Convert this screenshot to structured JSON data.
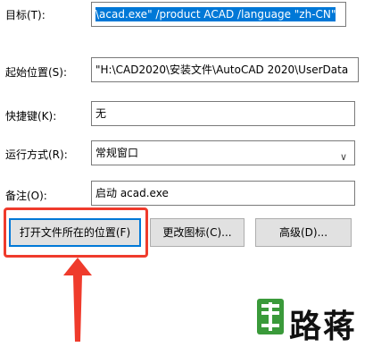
{
  "target": {
    "label": "目标(T):",
    "value": "\\acad.exe\"  /product ACAD /language \"zh-CN\""
  },
  "start_in": {
    "label": "起始位置(S):",
    "value": "\"H:\\CAD2020\\安装文件\\AutoCAD 2020\\UserData"
  },
  "shortcut_key": {
    "label": "快捷键(K):",
    "value": "无"
  },
  "run": {
    "label": "运行方式(R):",
    "value": "常规窗口"
  },
  "comment": {
    "label": "备注(O):",
    "value": "启动 acad.exe"
  },
  "buttons": {
    "open_location": "打开文件所在的位置(F)",
    "change_icon": "更改图标(C)...",
    "advanced": "高级(D)..."
  },
  "watermark": {
    "text": "路蒋",
    "colors": {
      "green": "#3a9a3a",
      "black": "#111111"
    }
  },
  "colors": {
    "highlight": "#0078d7",
    "annotation": "#ef3b2c"
  }
}
